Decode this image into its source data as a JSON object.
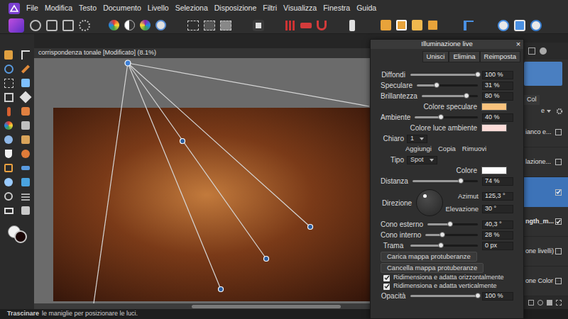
{
  "menu": [
    "File",
    "Modifica",
    "Testo",
    "Documento",
    "Livello",
    "Seleziona",
    "Disposizione",
    "Filtri",
    "Visualizza",
    "Finestra",
    "Guida"
  ],
  "document": {
    "title": "corrispondenza tonale [Modificato] (8.1%)"
  },
  "panel": {
    "title": "Illuminazione live",
    "close": "×",
    "actions": [
      "Unisci",
      "Elimina",
      "Reimposta"
    ],
    "rows": [
      {
        "kind": "slider",
        "label": "Diffondi",
        "level": 1,
        "reading": "100 %"
      },
      {
        "kind": "slider",
        "label": "Speculare",
        "level": 0.33,
        "reading": "31 %"
      },
      {
        "kind": "slider",
        "label": "Brillantezza",
        "level": 0.8,
        "reading": "80 %"
      },
      {
        "kind": "color",
        "label": "Colore speculare",
        "color": "#f9c27c"
      },
      {
        "kind": "slider",
        "label": "Ambiente",
        "level": 0.41,
        "reading": "40 %"
      },
      {
        "kind": "color",
        "label": "Colore luce ambiente",
        "color": "#fcdcd8"
      },
      {
        "kind": "select",
        "label": "Chiaro",
        "value": "1"
      },
      {
        "kind": "buttons",
        "items": [
          "Aggiungi",
          "Copia",
          "Rimuovi"
        ]
      },
      {
        "kind": "select",
        "label": "Tipo",
        "value": "Spot"
      },
      {
        "kind": "color",
        "label": "Colore",
        "color": "#ffffff"
      },
      {
        "kind": "slider",
        "label": "Distanza",
        "level": 0.74,
        "reading": "74 %"
      },
      {
        "kind": "dial",
        "label": "Direzione",
        "azimuth": 125.3,
        "fields": [
          {
            "label": "Azimut",
            "value": "125,3 °"
          },
          {
            "label": "Elevazione",
            "value": "30 °"
          }
        ]
      },
      {
        "kind": "slider",
        "label": "Cono esterno",
        "level": 0.45,
        "reading": "40,3 °"
      },
      {
        "kind": "slider",
        "label": "Cono interno",
        "level": 0.32,
        "reading": "28 %"
      },
      {
        "kind": "slider",
        "label": "Trama",
        "level": 0.45,
        "reading": "0 px"
      },
      {
        "kind": "button",
        "label": "Carica mappa protuberanze"
      },
      {
        "kind": "button",
        "label": "Cancella mappa protuberanze"
      },
      {
        "kind": "checkbox",
        "label": "Ridimensiona e adatta orizzontalmente",
        "checked": true
      },
      {
        "kind": "checkbox",
        "label": "Ridimensiona e adatta verticalmente",
        "checked": true
      },
      {
        "kind": "slider",
        "label": "Opacità",
        "level": 1,
        "reading": "100 %"
      }
    ]
  },
  "layers": {
    "top_item_selected": true,
    "tab": "Col",
    "blend_mode": "e",
    "items": [
      {
        "text": "ianco e...",
        "bold": false,
        "selected": false,
        "checked": false
      },
      {
        "text": "lazione...",
        "bold": false,
        "selected": false,
        "checked": false
      },
      {
        "selected": true,
        "checked": true
      },
      {
        "text": "ngth_m...",
        "bold": true,
        "selected": false,
        "checked": true
      },
      {
        "text": "one livelli)",
        "bold": false,
        "selected": false,
        "checked": false
      },
      {
        "text": "one Color",
        "bold": false,
        "selected": false,
        "checked": false
      }
    ]
  },
  "status_bar": [
    {
      "text": "Trascinare",
      "bold": true
    },
    {
      "text": "le maniglie per posizionare le luci.",
      "bold": false
    }
  ]
}
